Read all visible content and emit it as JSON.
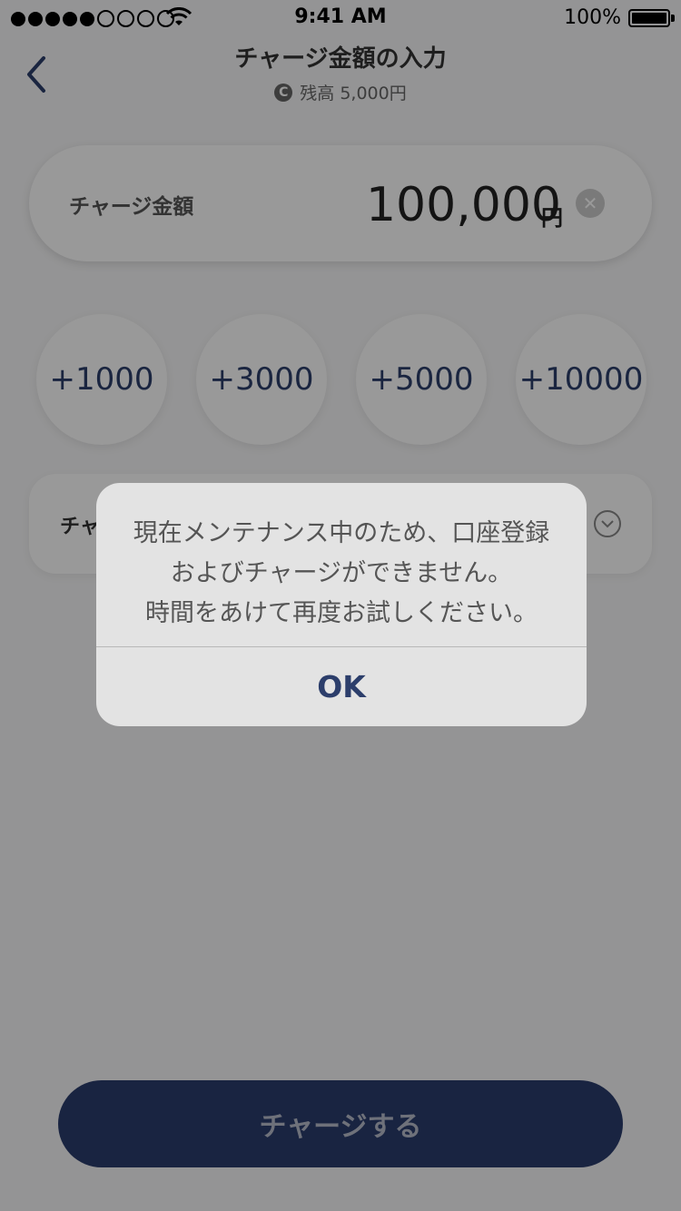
{
  "status_bar": {
    "time": "9:41 AM",
    "battery_percent": "100%",
    "signal_bars_filled": 5,
    "signal_bars_total": 9,
    "wifi_icon": "wifi-icon"
  },
  "header": {
    "title": "チャージ金額の入力",
    "balance_icon": "coin-icon",
    "balance_icon_glyph": "C",
    "balance_text": "残高 5,000円"
  },
  "amount": {
    "label": "チャージ金額",
    "value": "100,000",
    "unit": "円",
    "clear_glyph": "✕"
  },
  "quick_amounts": [
    "+1000",
    "+3000",
    "+5000",
    "+10000"
  ],
  "method": {
    "label": "チャ"
  },
  "charge_button": {
    "label": "チャージする"
  },
  "alert": {
    "message_lines": [
      "現在メンテナンス中のため、口座登録",
      "およびチャージができません。",
      "時間をあけて再度お試しください。"
    ],
    "ok_label": "OK"
  },
  "colors": {
    "accent": "#2c3e6b",
    "button": "#2b3c6d",
    "overlay": "rgba(0,0,0,0.4)"
  }
}
